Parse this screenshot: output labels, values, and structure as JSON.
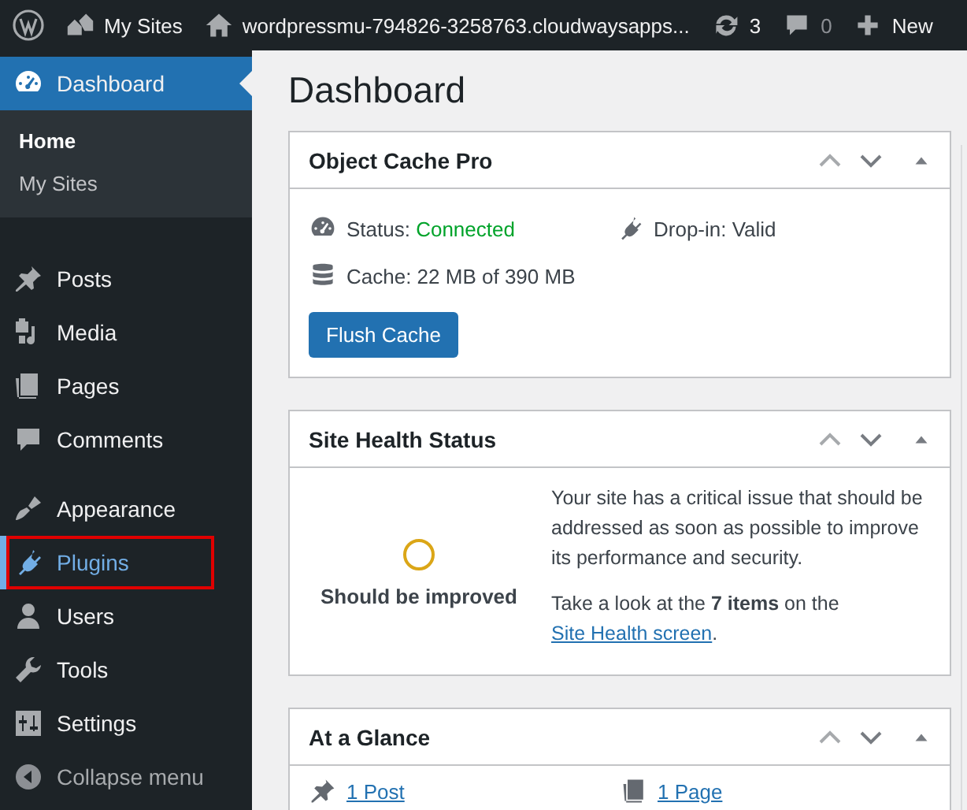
{
  "admin_bar": {
    "sites_label": "My Sites",
    "site_name": "wordpressmu-794826-3258763.cloudwaysapps...",
    "updates_count": "3",
    "comments_count": "0",
    "new_label": "New"
  },
  "sidebar": {
    "items": [
      {
        "label": "Dashboard",
        "selected": true,
        "highlighted": false,
        "children": [
          {
            "label": "Home",
            "selected": true
          },
          {
            "label": "My Sites",
            "selected": false
          }
        ]
      },
      {
        "label": "Posts",
        "selected": false,
        "highlighted": false
      },
      {
        "label": "Media",
        "selected": false,
        "highlighted": false
      },
      {
        "label": "Pages",
        "selected": false,
        "highlighted": false
      },
      {
        "label": "Comments",
        "selected": false,
        "highlighted": false
      },
      {
        "label": "Appearance",
        "selected": false,
        "highlighted": false
      },
      {
        "label": "Plugins",
        "selected": false,
        "highlighted": true
      },
      {
        "label": "Users",
        "selected": false,
        "highlighted": false
      },
      {
        "label": "Tools",
        "selected": false,
        "highlighted": false
      },
      {
        "label": "Settings",
        "selected": false,
        "highlighted": false
      }
    ],
    "collapse_label": "Collapse menu"
  },
  "page_title": "Dashboard",
  "widgets": [
    {
      "kind": "cache",
      "title": "Object Cache Pro",
      "status_label": "Status:",
      "status_value": "Connected",
      "dropin": "Drop-in: Valid",
      "cache": "Cache: 22 MB of 390 MB",
      "button": "Flush Cache"
    },
    {
      "kind": "health",
      "title": "Site Health Status",
      "rating": "Should be improved",
      "message": "Your site has a critical issue that should be addressed as soon as possible to improve its performance and security.",
      "prompt": "Take a look at the **7 items** on the ",
      "link": "Site Health screen",
      "after": "."
    },
    {
      "kind": "glance",
      "title": "At a Glance",
      "items": [
        {
          "label": "1 Post"
        },
        {
          "label": "1 Page"
        }
      ]
    }
  ]
}
